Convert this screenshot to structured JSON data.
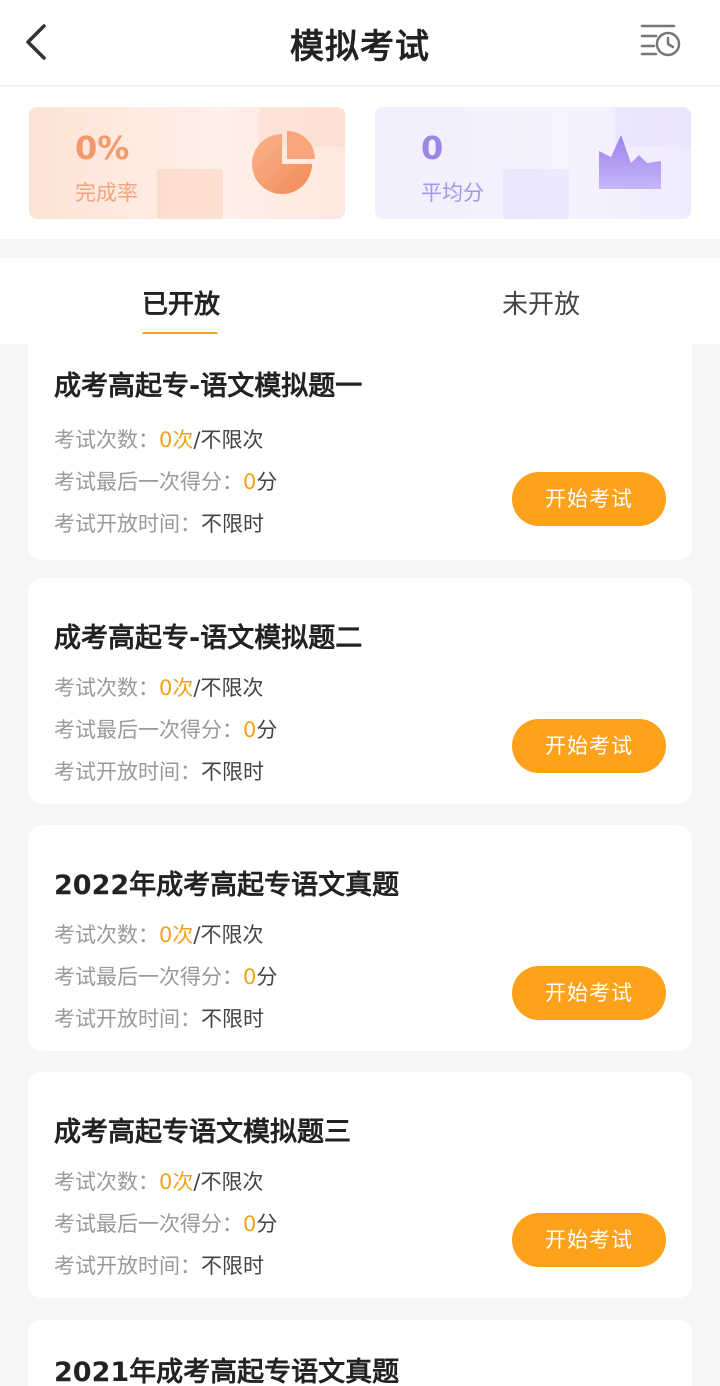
{
  "header": {
    "title": "模拟考试",
    "back_icon": "chevron-left-icon",
    "history_icon": "history-clock-icon"
  },
  "stats": {
    "completion": {
      "value": "0%",
      "label": "完成率",
      "icon": "pie-chart-icon",
      "color": "#f29a6c"
    },
    "average": {
      "value": "0",
      "label": "平均分",
      "icon": "area-chart-icon",
      "color": "#9b86e3"
    }
  },
  "tabs": [
    {
      "label": "已开放",
      "active": true
    },
    {
      "label": "未开放",
      "active": false
    }
  ],
  "accent": "#fda21a",
  "cards": [
    {
      "title": "成考高起专-语文模拟题一",
      "attempts_label": "考试次数：",
      "attempts_value": "0次",
      "attempts_suffix": "/不限次",
      "score_label": "考试最后一次得分：",
      "score_value": "0",
      "score_unit": "分",
      "time_label": "考试开放时间：",
      "time_value": "不限时",
      "button": "开始考试"
    },
    {
      "title": "成考高起专-语文模拟题二",
      "attempts_label": "考试次数：",
      "attempts_value": "0次",
      "attempts_suffix": "/不限次",
      "score_label": "考试最后一次得分：",
      "score_value": "0",
      "score_unit": "分",
      "time_label": "考试开放时间：",
      "time_value": "不限时",
      "button": "开始考试"
    },
    {
      "title": "2022年成考高起专语文真题",
      "attempts_label": "考试次数：",
      "attempts_value": "0次",
      "attempts_suffix": "/不限次",
      "score_label": "考试最后一次得分：",
      "score_value": "0",
      "score_unit": "分",
      "time_label": "考试开放时间：",
      "time_value": "不限时",
      "button": "开始考试"
    },
    {
      "title": "成考高起专语文模拟题三",
      "attempts_label": "考试次数：",
      "attempts_value": "0次",
      "attempts_suffix": "/不限次",
      "score_label": "考试最后一次得分：",
      "score_value": "0",
      "score_unit": "分",
      "time_label": "考试开放时间：",
      "time_value": "不限时",
      "button": "开始考试"
    },
    {
      "title": "2021年成考高起专语文真题"
    }
  ]
}
